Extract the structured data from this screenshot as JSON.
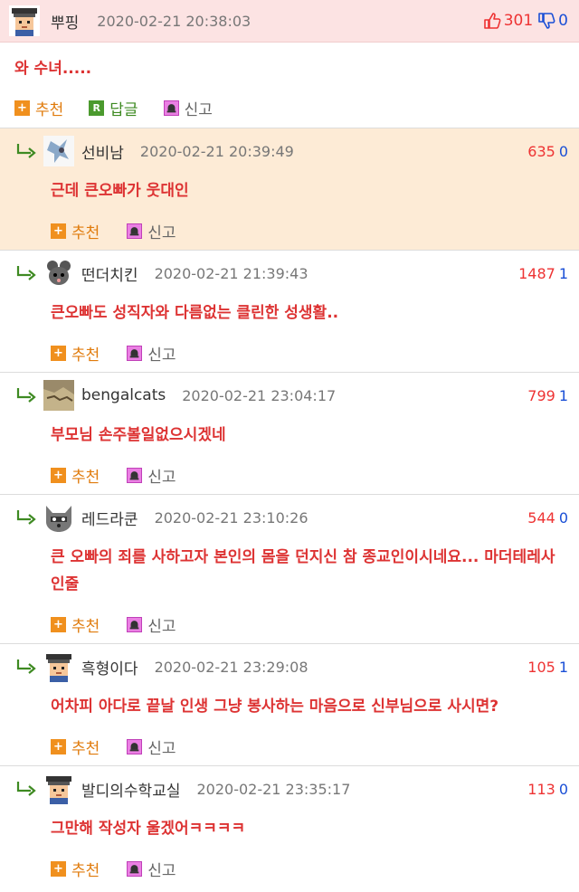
{
  "post": {
    "author": "뿌핑",
    "date": "2020-02-21 20:38:03",
    "upvotes": "301",
    "downvotes": "0",
    "text": "와 수녀.....",
    "actions": {
      "recommend": "추천",
      "reply": "답글",
      "report": "신고",
      "reply_icon": "R"
    }
  },
  "comments": [
    {
      "author": "선비남",
      "date": "2020-02-21 20:39:49",
      "up": "635",
      "down": "0",
      "text": "근데 큰오빠가 웃대인",
      "recommend": "추천",
      "report": "신고"
    },
    {
      "author": "떤더치킨",
      "date": "2020-02-21 21:39:43",
      "up": "1487",
      "down": "1",
      "text": "큰오빠도 성직자와 다름없는 클린한 성생활..",
      "recommend": "추천",
      "report": "신고"
    },
    {
      "author": "bengalcats",
      "date": "2020-02-21 23:04:17",
      "up": "799",
      "down": "1",
      "text": "부모님 손주볼일없으시겠네",
      "recommend": "추천",
      "report": "신고"
    },
    {
      "author": "레드라쿤",
      "date": "2020-02-21 23:10:26",
      "up": "544",
      "down": "0",
      "text": "큰 오빠의 죄를 사하고자 본인의 몸을 던지신 참 종교인이시네요... 마더테레사인줄",
      "recommend": "추천",
      "report": "신고"
    },
    {
      "author": "흑형이다",
      "date": "2020-02-21 23:29:08",
      "up": "105",
      "down": "1",
      "text": "어차피 아다로 끝날 인생 그냥 봉사하는 마음으로 신부님으로 사시면?",
      "recommend": "추천",
      "report": "신고"
    },
    {
      "author": "발디의수학교실",
      "date": "2020-02-21 23:35:17",
      "up": "113",
      "down": "0",
      "text": "그만해 작성자 울겠어ㅋㅋㅋㅋ",
      "recommend": "추천",
      "report": "신고"
    }
  ],
  "icons": {
    "thumb_up": "thumb-up-icon",
    "thumb_down": "thumb-down-icon",
    "recommend": "plus-icon",
    "reply": "reply-r-icon",
    "report": "alarm-bell-icon",
    "reply_arrow": "reply-arrow-icon"
  },
  "colors": {
    "accent_red": "#dd3333",
    "vote_blue": "#1a4fd6",
    "header_bg": "#fce3e3",
    "highlight_bg": "#fdebd6"
  }
}
